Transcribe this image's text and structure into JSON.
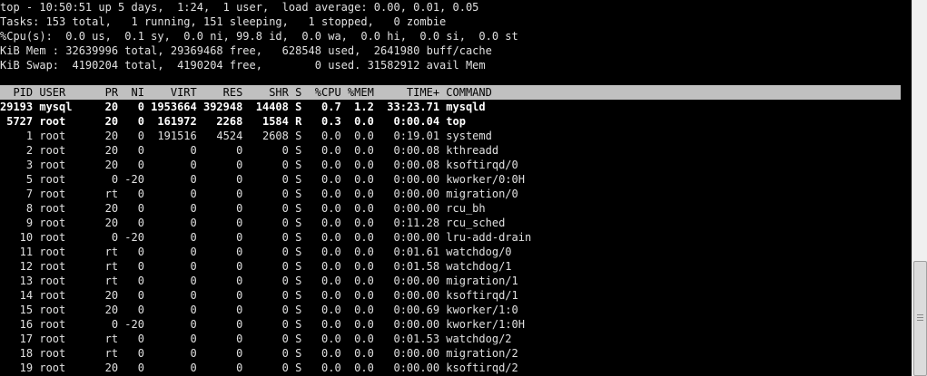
{
  "terminal": {
    "summary": [
      "top - 10:50:51 up 5 days,  1:24,  1 user,  load average: 0.00, 0.01, 0.05",
      "Tasks: 153 total,   1 running, 151 sleeping,   1 stopped,   0 zombie",
      "%Cpu(s):  0.0 us,  0.1 sy,  0.0 ni, 99.8 id,  0.0 wa,  0.0 hi,  0.0 si,  0.0 st",
      "KiB Mem : 32639996 total, 29369468 free,   628548 used,  2641980 buff/cache",
      "KiB Swap:  4190204 total,  4190204 free,        0 used. 31582912 avail Mem"
    ],
    "column_header": "  PID USER      PR  NI    VIRT    RES    SHR S  %CPU %MEM     TIME+ COMMAND",
    "rows": [
      "29193 mysql     20   0 1953664 392948  14408 S   0.7  1.2  33:23.71 mysqld",
      " 5727 root      20   0  161972   2268   1584 R   0.3  0.0   0:00.04 top",
      "    1 root      20   0  191516   4524   2608 S   0.0  0.0   0:19.01 systemd",
      "    2 root      20   0       0      0      0 S   0.0  0.0   0:00.08 kthreadd",
      "    3 root      20   0       0      0      0 S   0.0  0.0   0:00.08 ksoftirqd/0",
      "    5 root       0 -20       0      0      0 S   0.0  0.0   0:00.00 kworker/0:0H",
      "    7 root      rt   0       0      0      0 S   0.0  0.0   0:00.00 migration/0",
      "    8 root      20   0       0      0      0 S   0.0  0.0   0:00.00 rcu_bh",
      "    9 root      20   0       0      0      0 S   0.0  0.0   0:11.28 rcu_sched",
      "   10 root       0 -20       0      0      0 S   0.0  0.0   0:00.00 lru-add-drain",
      "   11 root      rt   0       0      0      0 S   0.0  0.0   0:01.61 watchdog/0",
      "   12 root      rt   0       0      0      0 S   0.0  0.0   0:01.58 watchdog/1",
      "   13 root      rt   0       0      0      0 S   0.0  0.0   0:00.00 migration/1",
      "   14 root      20   0       0      0      0 S   0.0  0.0   0:00.00 ksoftirqd/1",
      "   15 root      20   0       0      0      0 S   0.0  0.0   0:00.69 kworker/1:0",
      "   16 root       0 -20       0      0      0 S   0.0  0.0   0:00.00 kworker/1:0H",
      "   17 root      rt   0       0      0      0 S   0.0  0.0   0:01.53 watchdog/2",
      "   18 root      rt   0       0      0      0 S   0.0  0.0   0:00.00 migration/2",
      "   19 root      20   0       0      0      0 S   0.0  0.0   0:00.00 ksoftirqd/2"
    ]
  },
  "colors": {
    "background": "#000000",
    "text": "#e0e0e0",
    "header_bar": "#c0c0c0",
    "header_text": "#000000"
  }
}
